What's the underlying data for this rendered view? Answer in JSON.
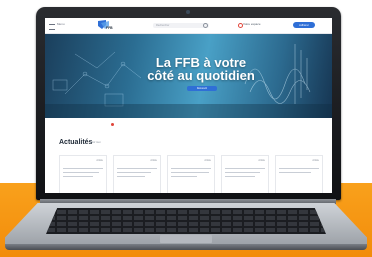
{
  "header": {
    "menu_label": "Menu",
    "logo_text": "FFB",
    "search_placeholder": "Rechercher",
    "account_label": "Votre espace",
    "cta_label": "Adhérer"
  },
  "hero": {
    "title_line1": "La FFB à votre",
    "title_line2": "côté au quotidien",
    "button_label": "Découvrir"
  },
  "info_strip": "",
  "news": {
    "title": "Actualités",
    "more_label": "Voir tout",
    "cards": [
      {
        "tag": "Article",
        "heading": ""
      },
      {
        "tag": "Article",
        "heading": ""
      },
      {
        "tag": "Article",
        "heading": ""
      },
      {
        "tag": "Article",
        "heading": ""
      },
      {
        "tag": "Article",
        "heading": ""
      }
    ]
  },
  "colors": {
    "floor": "#f28c0a",
    "accent": "#2f6fd6",
    "laptop_frame": "#1a1b1f"
  }
}
